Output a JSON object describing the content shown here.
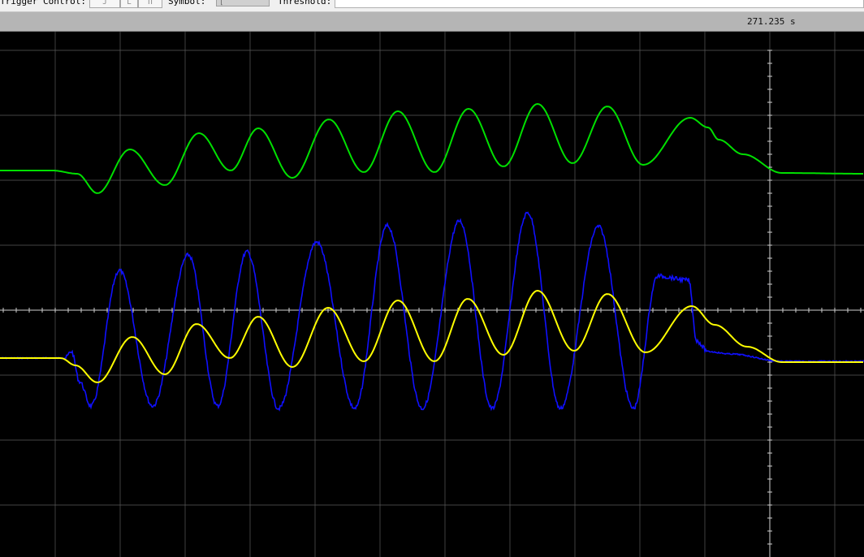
{
  "toolbar": {
    "trigger_label": "Trigger Control:",
    "symbol_label": "Symbol:",
    "threshold_label": "Threshold:"
  },
  "timebar": {
    "cursor_time": "271.235 s"
  },
  "colors": {
    "background": "#000000",
    "grid": "#5a5a5a",
    "axis": "#cfcfcf",
    "green_trace": "#00e000",
    "blue_trace": "#1010ff",
    "yellow_trace": "#ffff00"
  }
}
